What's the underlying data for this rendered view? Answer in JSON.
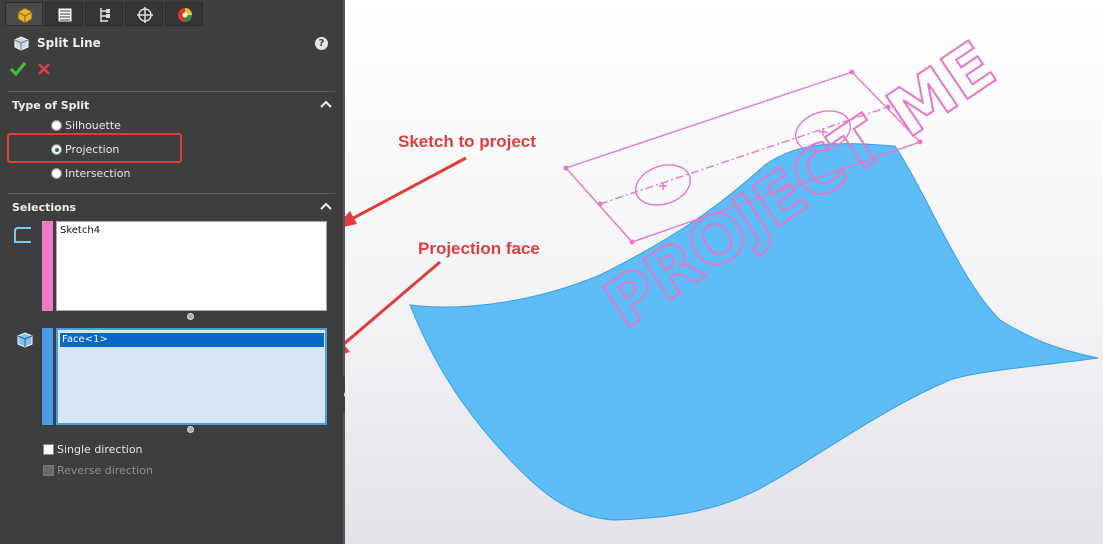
{
  "panel": {
    "tabs": [
      {
        "icon": "feature-manager-icon",
        "active": true
      },
      {
        "icon": "property-manager-icon",
        "active": false
      },
      {
        "icon": "configuration-manager-icon",
        "active": false
      },
      {
        "icon": "dimxpert-manager-icon",
        "active": false
      },
      {
        "icon": "display-manager-icon",
        "active": false
      }
    ],
    "title": "Split Line",
    "help_icon": "help-icon",
    "ok_icon": "checkmark-icon",
    "cancel_icon": "close-icon"
  },
  "type_of_split": {
    "header": "Type of Split",
    "options": [
      {
        "label": "Silhouette",
        "checked": false
      },
      {
        "label": "Projection",
        "checked": true
      },
      {
        "label": "Intersection",
        "checked": false
      }
    ]
  },
  "selections": {
    "header": "Selections",
    "sketch_box": {
      "value": "Sketch4",
      "stripe_color": "#f07ac6"
    },
    "face_box": {
      "value": "Face<1>",
      "stripe_color": "#4a9be8"
    },
    "single_direction": {
      "label": "Single direction",
      "checked": false,
      "enabled": true
    },
    "reverse_direction": {
      "label": "Reverse direction",
      "checked": false,
      "enabled": false
    }
  },
  "viewport": {
    "callouts": {
      "sketch": "Sketch to project",
      "face": "Projection face"
    },
    "surface_color": "#5ebcf7",
    "sketch_color": "#e776c8",
    "projected_text": "PROJECT ME"
  },
  "colors": {
    "panel_bg": "#3e3e3e",
    "highlight": "#e03c3c",
    "selection_blue": "#0a66c8"
  }
}
